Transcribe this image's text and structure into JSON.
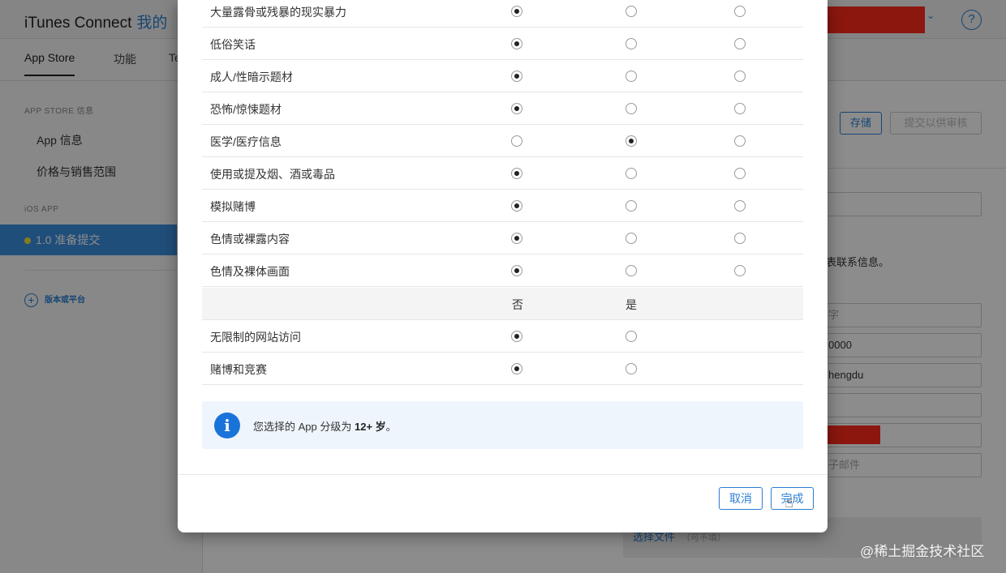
{
  "app": {
    "brand": "iTunes Connect",
    "brand_section": "我的",
    "tabs": [
      "App Store",
      "功能",
      "Te"
    ],
    "help_icon": "?",
    "chevron_icon": "⌄"
  },
  "sidebar": {
    "section1": "APP STORE 信息",
    "items": [
      "App 信息",
      "价格与销售范围"
    ],
    "section2": "iOS APP",
    "active_item": "1.0 准备提交",
    "add_label": "版本或平台"
  },
  "background_form": {
    "save_label": "存储",
    "submit_label": "提交以供审核",
    "contact_text": "表联系信息。",
    "field_values": [
      "字",
      "0000",
      "hengdu",
      "",
      "",
      "子邮件"
    ],
    "choose_file": "选择文件",
    "optional": "（可不填）"
  },
  "modal": {
    "rows": [
      {
        "label": "大量露骨或残暴的现实暴力",
        "selected": 0
      },
      {
        "label": "低俗笑话",
        "selected": 0
      },
      {
        "label": "成人/性暗示题材",
        "selected": 0
      },
      {
        "label": "恐怖/惊悚题材",
        "selected": 0
      },
      {
        "label": "医学/医疗信息",
        "selected": 1
      },
      {
        "label": "使用或提及烟、酒或毒品",
        "selected": 0
      },
      {
        "label": "模拟赌博",
        "selected": 0
      },
      {
        "label": "色情或裸露内容",
        "selected": 0
      },
      {
        "label": "色情及裸体画面",
        "selected": 0
      }
    ],
    "binary_header": {
      "no": "否",
      "yes": "是"
    },
    "binary_rows": [
      {
        "label": "无限制的网站访问",
        "selected": 0
      },
      {
        "label": "赌博和竞赛",
        "selected": 0
      }
    ],
    "info": {
      "icon": "i",
      "prefix": "您选择的 App 分级为",
      "rating": "12+ 岁",
      "suffix": "。"
    },
    "cancel_label": "取消",
    "done_label": "完成"
  },
  "watermark": "@稀土掘金技术社区",
  "colors": {
    "accent": "#2a7fd4",
    "sidebar_active": "#3b8ee0",
    "status_dot": "#f4e23a",
    "redaction": "#ff2b1c",
    "info_icon": "#1a73d9"
  }
}
